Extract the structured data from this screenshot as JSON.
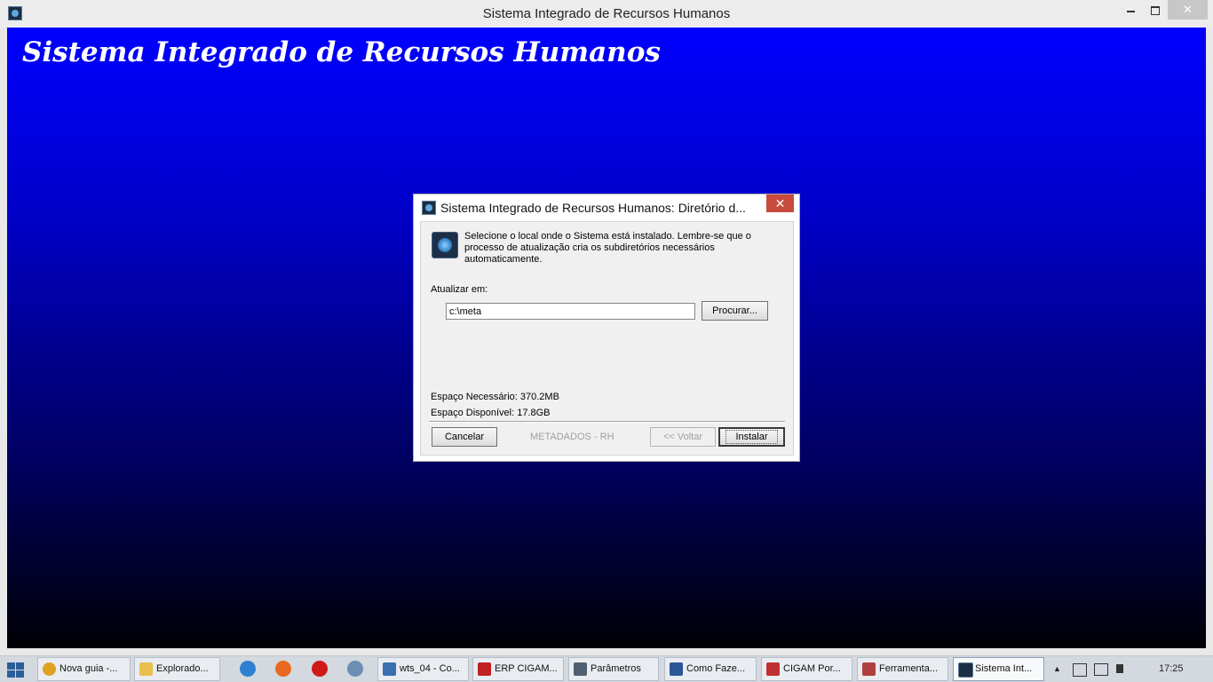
{
  "window": {
    "title": "Sistema Integrado de Recursos Humanos",
    "close_glyph": "✕"
  },
  "app": {
    "heading": "Sistema Integrado de Recursos Humanos"
  },
  "dialog": {
    "title": "Sistema Integrado de Recursos Humanos: Diretório d...",
    "close_glyph": "✕",
    "description": "Selecione o local onde o Sistema está instalado. Lembre-se que o processo de atualização cria os subdiretórios necessários automaticamente.",
    "update_label": "Atualizar em:",
    "path_value": "c:\\meta",
    "browse_label": "Procurar...",
    "space_required": "Espaço Necessário: 370.2MB",
    "space_available": "Espaço Disponível: 17.8GB",
    "cancel_label": "Cancelar",
    "brand": "METADADOS - RH",
    "back_label": "<< Voltar",
    "install_label": "Instalar"
  },
  "taskbar": {
    "items": [
      {
        "label": "Nova guia -...",
        "icon": "chrome-icon",
        "color": "#e0a020"
      },
      {
        "label": "Explorado...",
        "icon": "folder-icon",
        "color": "#e8c050"
      },
      {
        "label": "wts_04 - Co...",
        "icon": "remote-desktop-icon",
        "color": "#3a6fb0"
      },
      {
        "label": "ERP CIGAM...",
        "icon": "cigam-icon",
        "color": "#c02020"
      },
      {
        "label": "Parâmetros",
        "icon": "window-icon",
        "color": "#506070"
      },
      {
        "label": "Como Faze...",
        "icon": "word-icon",
        "color": "#2b5797"
      },
      {
        "label": "CIGAM Por...",
        "icon": "cigam-portal-icon",
        "color": "#c03030"
      },
      {
        "label": "Ferramenta...",
        "icon": "tools-icon",
        "color": "#b04040"
      },
      {
        "label": "Sistema Int...",
        "icon": "metadados-icon",
        "color": "#1b2e44"
      }
    ],
    "clock": "17:25",
    "tray_up": "▲"
  }
}
